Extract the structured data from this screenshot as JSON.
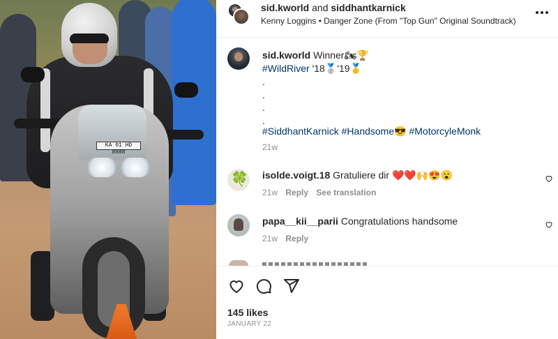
{
  "header": {
    "author": "sid.kworld",
    "joiner": "and",
    "collaborator": "siddhantkarnick",
    "audio": "Kenny Loggins • Danger Zone (From \"Top Gun\" Original Soundtrack)",
    "more_icon": "more-horizontal-icon"
  },
  "photo": {
    "plate_text": "KA 01 HD 8888"
  },
  "caption": {
    "username": "sid.kworld",
    "line1_text": "Winner",
    "line1_emoji": "🏍🏆",
    "line2_tag": "#WildRiver",
    "line2_year1": "'18",
    "line2_medal1": "🥈",
    "line2_year2": "'19",
    "line2_medal2": "🥇",
    "dots": [
      ".",
      ".",
      ".",
      "."
    ],
    "tag1": "#SiddhantKarnick",
    "tag2": "#Handsome",
    "tag2_emoji": "😎",
    "tag3": "#MotorcyleMonk",
    "time": "21w"
  },
  "comments": [
    {
      "username": "isolde.voigt.18",
      "text": "Gratuliere dir",
      "emoji": "❤️❤️🙌😍😮",
      "time": "21w",
      "reply": "Reply",
      "translate": "See translation"
    },
    {
      "username": "papa__kii__parii",
      "text": "Congratulations handsome",
      "time": "21w",
      "reply": "Reply"
    }
  ],
  "actions": {
    "like_icon": "heart-icon",
    "comment_icon": "comment-icon",
    "share_icon": "share-icon"
  },
  "footer": {
    "likes": "145 likes",
    "date": "JANUARY 22"
  },
  "colors": {
    "text": "#262626",
    "muted": "#8e8e8e",
    "hashtag": "#00376b",
    "divider": "#efefef",
    "heart_red": "#ed4956"
  }
}
